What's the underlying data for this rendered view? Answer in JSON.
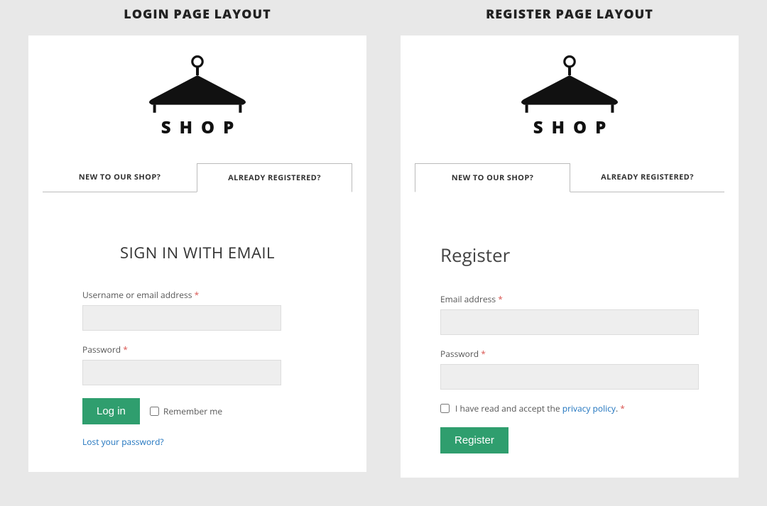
{
  "left": {
    "heading": "LOGIN PAGE LAYOUT",
    "logo_text": "SHOP",
    "tabs": {
      "new": "NEW TO OUR SHOP?",
      "already": "ALREADY REGISTERED?"
    },
    "form": {
      "title": "SIGN IN WITH EMAIL",
      "username_label": "Username or email address",
      "password_label": "Password",
      "required": "*",
      "login_btn": "Log in",
      "remember": "Remember me",
      "lost": "Lost your password?"
    }
  },
  "right": {
    "heading": "REGISTER PAGE LAYOUT",
    "logo_text": "SHOP",
    "tabs": {
      "new": "NEW TO OUR SHOP?",
      "already": "ALREADY REGISTERED?"
    },
    "form": {
      "title": "Register",
      "email_label": "Email address",
      "password_label": "Password",
      "required": "*",
      "consent_pre": "I have read and accept the ",
      "consent_link": "privacy policy",
      "consent_post": ".",
      "register_btn": "Register"
    }
  }
}
